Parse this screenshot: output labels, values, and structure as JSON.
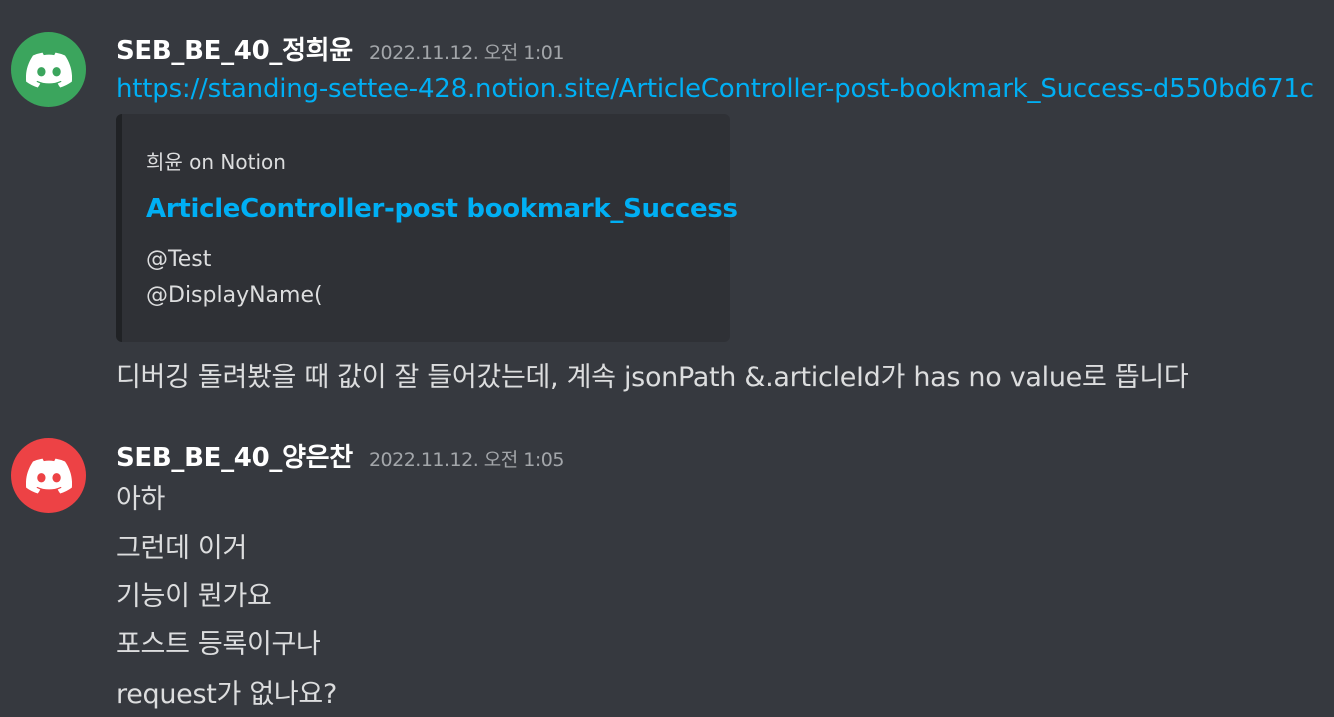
{
  "messages": [
    {
      "avatar_color": "#3ba55d",
      "avatar_icon": "discord-logo-icon",
      "username": "SEB_BE_40_정희윤",
      "timestamp": "2022.11.12. 오전 1:01",
      "link": "https://standing-settee-428.notion.site/ArticleController-post-bookmark_Success-d550bd671c",
      "embed": {
        "provider": "희윤 on Notion",
        "title": "ArticleController-post bookmark_Success",
        "description": [
          "@Test",
          "@DisplayName("
        ]
      },
      "text": "디버깅 돌려봤을 때 값이 잘 들어갔는데, 계속 jsonPath &.articleId가 has no value로 뜹니다"
    },
    {
      "avatar_color": "#ed4245",
      "avatar_icon": "discord-logo-icon",
      "username": "SEB_BE_40_양은찬",
      "timestamp": "2022.11.12. 오전 1:05",
      "lines": [
        "아하",
        "그런데 이거",
        "기능이 뭔가요",
        "포스트 등록이구나",
        "request가 없나요?"
      ]
    }
  ]
}
